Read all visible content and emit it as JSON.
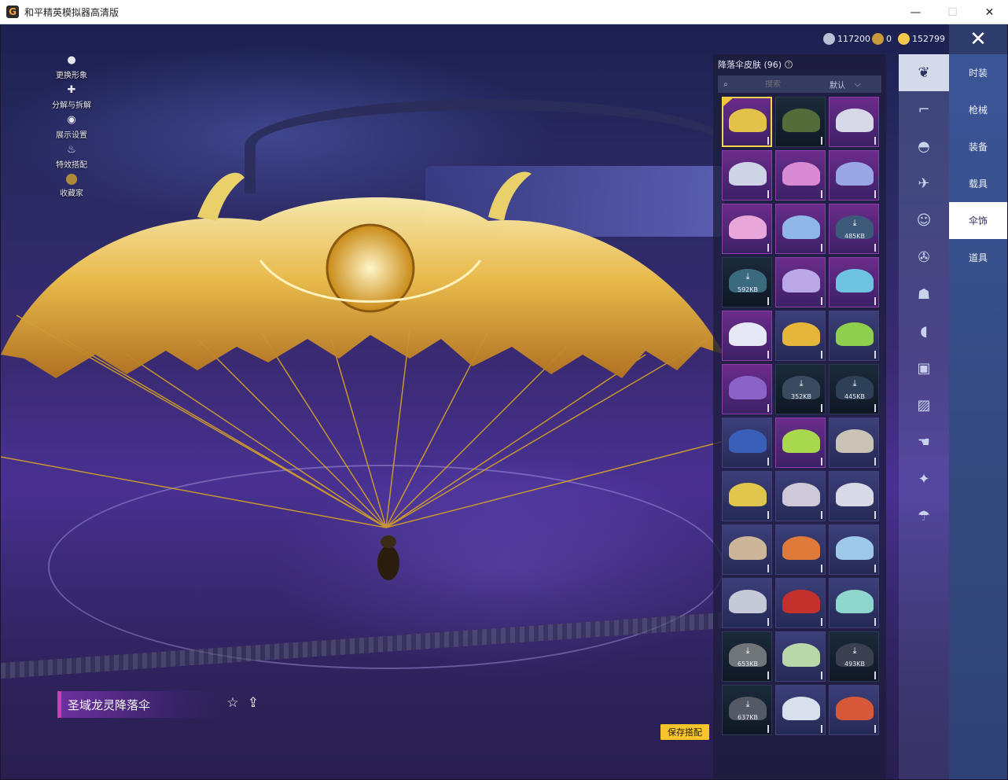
{
  "window": {
    "title": "和平精英模拟器高清版",
    "minimize": "—",
    "maximize": "☐",
    "close": "✕"
  },
  "currency": [
    {
      "icon": "silver-coin-icon",
      "value": "117200",
      "color": "#b9c0d8"
    },
    {
      "icon": "badge-coin-icon",
      "value": "0",
      "color": "#c89a3c"
    },
    {
      "icon": "gold-coin-icon",
      "value": "152799",
      "color": "#f2c94c"
    }
  ],
  "close_overlay": "✕",
  "left_menu": [
    {
      "icon": "person-icon",
      "label": "更换形象"
    },
    {
      "icon": "puzzle-icon",
      "label": "分解与拆解"
    },
    {
      "icon": "eye-icon",
      "label": "展示设置"
    },
    {
      "icon": "flame-icon",
      "label": "特效搭配"
    },
    {
      "icon": "collector-icon",
      "label": "收藏家"
    }
  ],
  "panel": {
    "title": "降落伞皮肤 (96)",
    "help": "?",
    "search_placeholder": "搜索",
    "sort": "默认",
    "sort_arrow": "⌵"
  },
  "grid": [
    {
      "style": "purple",
      "color": "#e3c24a",
      "selected": true
    },
    {
      "style": "dark",
      "color": "#566b3a"
    },
    {
      "style": "purple",
      "color": "#d7d9e8"
    },
    {
      "style": "purple",
      "color": "#cfd3e6"
    },
    {
      "style": "purple",
      "color": "#d88ad2"
    },
    {
      "style": "purple",
      "color": "#9aa6e6"
    },
    {
      "style": "purple",
      "color": "#e8a6d8"
    },
    {
      "style": "purple",
      "color": "#8fb6e8"
    },
    {
      "style": "purple",
      "color": "#3e5a7a",
      "download": "485KB"
    },
    {
      "style": "dark",
      "color": "#3b6a7e",
      "download": "592KB"
    },
    {
      "style": "purple",
      "color": "#b9a7e6"
    },
    {
      "style": "purple",
      "color": "#6fc3e2"
    },
    {
      "style": "purple",
      "color": "#e6e8f6"
    },
    {
      "style": "normal",
      "color": "#e6b63a"
    },
    {
      "style": "normal",
      "color": "#8fcf4e"
    },
    {
      "style": "purple",
      "color": "#8a63c9"
    },
    {
      "style": "dark",
      "color": "#3a4a5e",
      "download": "352KB"
    },
    {
      "style": "dark",
      "color": "#2e4058",
      "download": "445KB"
    },
    {
      "style": "normal",
      "color": "#3a5fb8"
    },
    {
      "style": "purple",
      "color": "#a8d84e"
    },
    {
      "style": "normal",
      "color": "#c9c3b6"
    },
    {
      "style": "normal",
      "color": "#e0c64c"
    },
    {
      "style": "normal",
      "color": "#cfc8d8"
    },
    {
      "style": "normal",
      "color": "#d8d8e6"
    },
    {
      "style": "normal",
      "color": "#cdb59a"
    },
    {
      "style": "normal",
      "color": "#e07a3a"
    },
    {
      "style": "normal",
      "color": "#9ec8e8"
    },
    {
      "style": "normal",
      "color": "#c6cad8"
    },
    {
      "style": "normal",
      "color": "#c4312c"
    },
    {
      "style": "normal",
      "color": "#8fd6cf"
    },
    {
      "style": "dark",
      "color": "#6f7578",
      "download": "653KB"
    },
    {
      "style": "normal",
      "color": "#b9d7a8"
    },
    {
      "style": "dark",
      "color": "#3a4050",
      "download": "493KB"
    },
    {
      "style": "dark",
      "color": "#535a66",
      "download": "637KB"
    },
    {
      "style": "normal",
      "color": "#d8e0ee"
    },
    {
      "style": "normal",
      "color": "#d8583a"
    }
  ],
  "category_icons": [
    {
      "icon": "outfit-icon",
      "active": true
    },
    {
      "icon": "gun-icon"
    },
    {
      "icon": "helmet-icon"
    },
    {
      "icon": "plane-icon"
    },
    {
      "icon": "emote-icon"
    },
    {
      "icon": "aircraft-icon"
    },
    {
      "icon": "robot-icon"
    },
    {
      "icon": "speaker-icon"
    },
    {
      "icon": "box-icon"
    },
    {
      "icon": "photo-icon"
    },
    {
      "icon": "hand-icon"
    },
    {
      "icon": "wand-icon"
    },
    {
      "icon": "parachute-icon"
    }
  ],
  "tabs": [
    {
      "label": "时装"
    },
    {
      "label": "枪械"
    },
    {
      "label": "装备"
    },
    {
      "label": "载具"
    },
    {
      "label": "伞饰",
      "active": true
    },
    {
      "label": "道具"
    }
  ],
  "item": {
    "name": "圣域龙灵降落伞",
    "favorite_icon": "☆",
    "share_icon": "⇪",
    "save_label": "保存搭配"
  }
}
